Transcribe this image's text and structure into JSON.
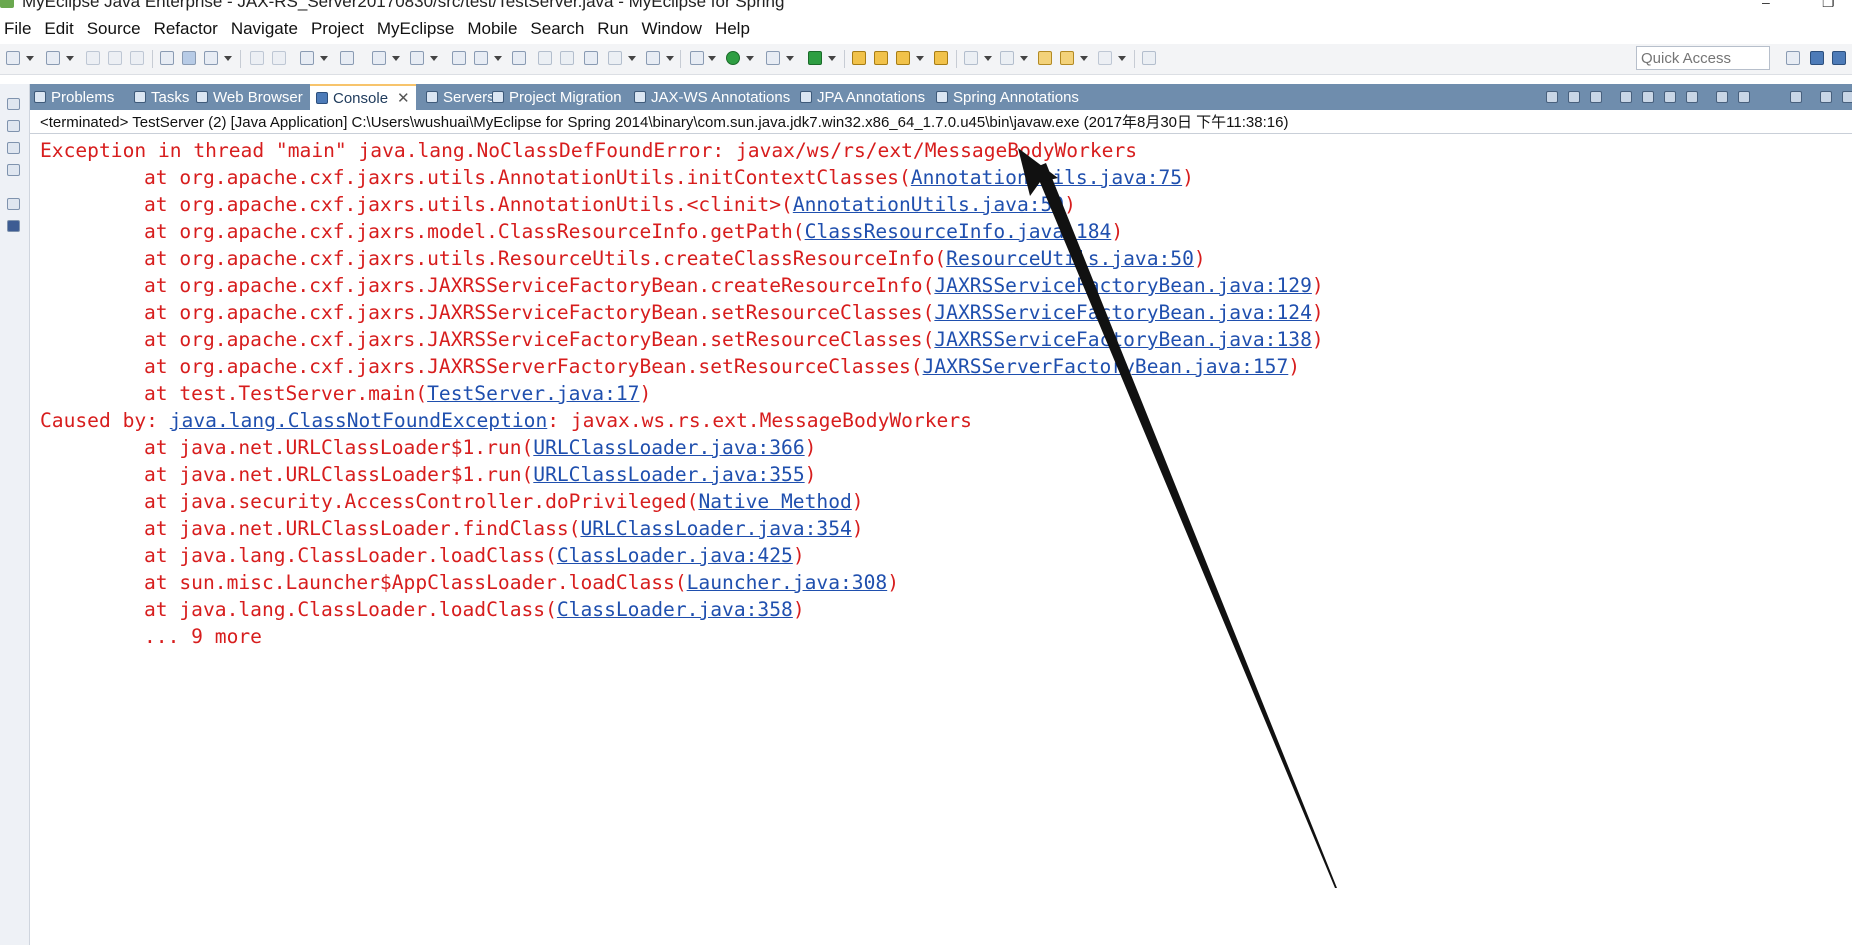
{
  "window": {
    "title": "MyEclipse Java Enterprise - JAX-RS_Server20170830/src/test/TestServer.java - MyEclipse for Spring",
    "minimize_glyph": "–",
    "restore_glyph": "❐"
  },
  "menu": {
    "items": [
      {
        "label": "File"
      },
      {
        "label": "Edit"
      },
      {
        "label": "Source"
      },
      {
        "label": "Refactor"
      },
      {
        "label": "Navigate"
      },
      {
        "label": "Project"
      },
      {
        "label": "MyEclipse"
      },
      {
        "label": "Mobile"
      },
      {
        "label": "Search"
      },
      {
        "label": "Run"
      },
      {
        "label": "Window"
      },
      {
        "label": "Help"
      }
    ]
  },
  "toolbar": {
    "quick_access_placeholder": "Quick Access"
  },
  "views": {
    "tabs": [
      {
        "label": "Problems",
        "icon": "problems-icon"
      },
      {
        "label": "Tasks",
        "icon": "tasks-icon"
      },
      {
        "label": "Web Browser",
        "icon": "web-browser-icon"
      },
      {
        "label": "Console",
        "icon": "console-icon",
        "active": true
      },
      {
        "label": "Servers",
        "icon": "servers-icon"
      },
      {
        "label": "Project Migration",
        "icon": "project-migration-icon"
      },
      {
        "label": "JAX-WS Annotations",
        "icon": "jax-ws-icon"
      },
      {
        "label": "JPA Annotations",
        "icon": "jpa-icon"
      },
      {
        "label": "Spring Annotations",
        "icon": "spring-icon"
      }
    ],
    "close_glyph": "✕"
  },
  "console": {
    "header": "<terminated> TestServer (2) [Java Application] C:\\Users\\wushuai\\MyEclipse for Spring 2014\\binary\\com.sun.java.jdk7.win32.x86_64_1.7.0.u45\\bin\\javaw.exe (2017年8月30日 下午11:38:16)",
    "lines": [
      {
        "pre": "Exception in thread \"main\" java.lang.NoClassDefFoundError: javax/ws/rs/ext/MessageBodyWorkers",
        "link": "",
        "post": ""
      },
      {
        "pre": "at org.apache.cxf.jaxrs.utils.AnnotationUtils.initContextClasses(",
        "link": "AnnotationUtils.java:75",
        "post": ")"
      },
      {
        "pre": "at org.apache.cxf.jaxrs.utils.AnnotationUtils.<clinit>(",
        "link": "AnnotationUtils.java:59",
        "post": ")"
      },
      {
        "pre": "at org.apache.cxf.jaxrs.model.ClassResourceInfo.getPath(",
        "link": "ClassResourceInfo.java:184",
        "post": ")"
      },
      {
        "pre": "at org.apache.cxf.jaxrs.utils.ResourceUtils.createClassResourceInfo(",
        "link": "ResourceUtils.java:50",
        "post": ")"
      },
      {
        "pre": "at org.apache.cxf.jaxrs.JAXRSServiceFactoryBean.createResourceInfo(",
        "link": "JAXRSServiceFactoryBean.java:129",
        "post": ")"
      },
      {
        "pre": "at org.apache.cxf.jaxrs.JAXRSServiceFactoryBean.setResourceClasses(",
        "link": "JAXRSServiceFactoryBean.java:124",
        "post": ")"
      },
      {
        "pre": "at org.apache.cxf.jaxrs.JAXRSServiceFactoryBean.setResourceClasses(",
        "link": "JAXRSServiceFactoryBean.java:138",
        "post": ")"
      },
      {
        "pre": "at org.apache.cxf.jaxrs.JAXRSServerFactoryBean.setResourceClasses(",
        "link": "JAXRSServerFactoryBean.java:157",
        "post": ")"
      },
      {
        "pre": "at test.TestServer.main(",
        "link": "TestServer.java:17",
        "post": ")"
      },
      {
        "pre": "Caused by: ",
        "link": "java.lang.ClassNotFoundException",
        "post": ": javax.ws.rs.ext.MessageBodyWorkers"
      },
      {
        "pre": "at java.net.URLClassLoader$1.run(",
        "link": "URLClassLoader.java:366",
        "post": ")"
      },
      {
        "pre": "at java.net.URLClassLoader$1.run(",
        "link": "URLClassLoader.java:355",
        "post": ")"
      },
      {
        "pre": "at java.security.AccessController.doPrivileged(",
        "link": "Native Method",
        "post": ")"
      },
      {
        "pre": "at java.net.URLClassLoader.findClass(",
        "link": "URLClassLoader.java:354",
        "post": ")"
      },
      {
        "pre": "at java.lang.ClassLoader.loadClass(",
        "link": "ClassLoader.java:425",
        "post": ")"
      },
      {
        "pre": "at sun.misc.Launcher$AppClassLoader.loadClass(",
        "link": "Launcher.java:308",
        "post": ")"
      },
      {
        "pre": "at java.lang.ClassLoader.loadClass(",
        "link": "ClassLoader.java:358",
        "post": ")"
      },
      {
        "pre": "... 9 more",
        "link": "",
        "post": ""
      }
    ]
  },
  "colors": {
    "error_text": "#d71d1d",
    "link_text": "#1f4fae",
    "tabbar_bg": "#6f8dad",
    "arrow": "#111111"
  }
}
